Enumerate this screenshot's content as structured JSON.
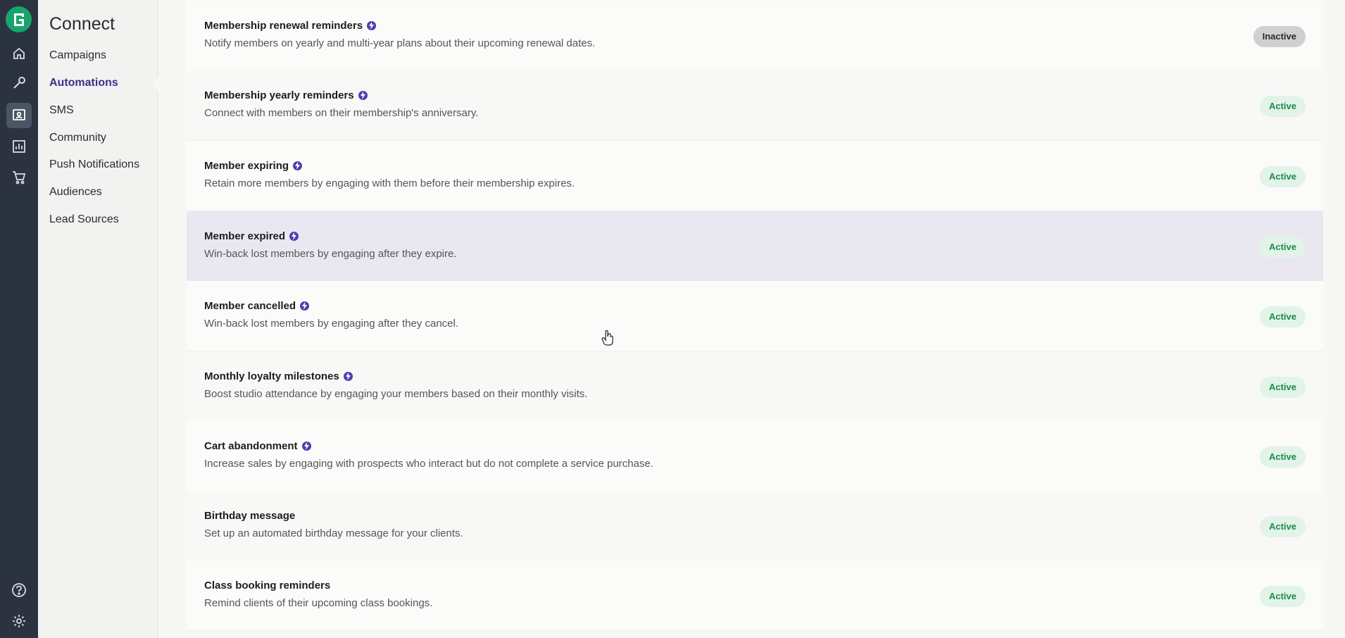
{
  "app": {
    "section_title": "Connect"
  },
  "rail": {
    "icons": [
      "logo-icon",
      "home-icon",
      "wrench-icon",
      "connect-icon",
      "reports-icon",
      "cart-icon",
      "help-icon",
      "settings-icon"
    ]
  },
  "subnav": {
    "items": [
      {
        "label": "Campaigns"
      },
      {
        "label": "Automations",
        "active": true
      },
      {
        "label": "SMS"
      },
      {
        "label": "Community"
      },
      {
        "label": "Push Notifications"
      },
      {
        "label": "Audiences"
      },
      {
        "label": "Lead Sources"
      }
    ]
  },
  "automations": [
    {
      "title": "Membership renewal reminders",
      "description": "Notify members on yearly and multi-year plans about their upcoming renewal dates.",
      "status": "Inactive",
      "premium": true
    },
    {
      "title": "Membership yearly reminders",
      "description": "Connect with members on their membership's anniversary.",
      "status": "Active",
      "premium": true
    },
    {
      "title": "Member expiring",
      "description": "Retain more members by engaging with them before their membership expires.",
      "status": "Active",
      "premium": true
    },
    {
      "title": "Member expired",
      "description": "Win-back lost members by engaging after they expire.",
      "status": "Active",
      "premium": true
    },
    {
      "title": "Member cancelled",
      "description": "Win-back lost members by engaging after they cancel.",
      "status": "Active",
      "premium": true
    },
    {
      "title": "Monthly loyalty milestones",
      "description": "Boost studio attendance by engaging your members based on their monthly visits.",
      "status": "Active",
      "premium": true
    },
    {
      "title": "Cart abandonment",
      "description": "Increase sales by engaging with prospects who interact but do not complete a service purchase.",
      "status": "Active",
      "premium": true
    },
    {
      "title": "Birthday message",
      "description": "Set up an automated birthday message for your clients.",
      "status": "Active",
      "premium": false
    },
    {
      "title": "Class booking reminders",
      "description": "Remind clients of their upcoming class bookings.",
      "status": "Active",
      "premium": false
    }
  ],
  "colors": {
    "rail_bg": "#2b3341",
    "brand_green": "#19a46e",
    "accent_purple": "#3d2f8a",
    "active_badge_bg": "#e2f3e9",
    "active_badge_text": "#1d8a4c",
    "inactive_badge_bg": "#d0d0d0"
  }
}
